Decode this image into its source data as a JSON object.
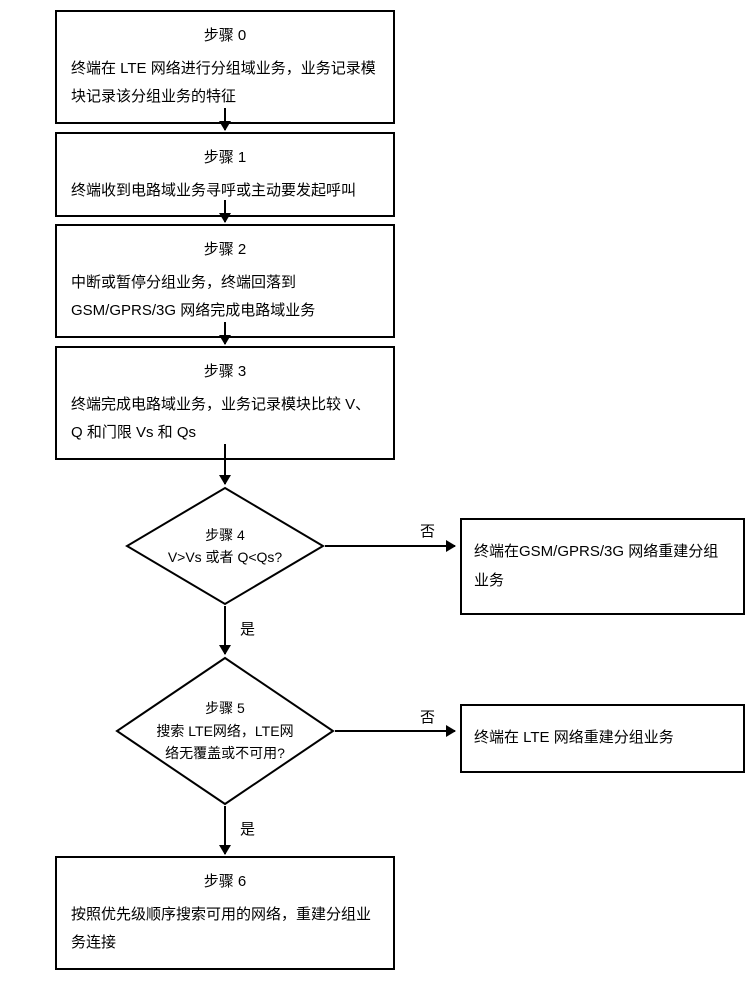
{
  "step0": {
    "title": "步骤 0",
    "text": "终端在 LTE 网络进行分组域业务，业务记录模块记录该分组业务的特征"
  },
  "step1": {
    "title": "步骤 1",
    "text": "终端收到电路域业务寻呼或主动要发起呼叫"
  },
  "step2": {
    "title": "步骤 2",
    "text": "中断或暂停分组业务，终端回落到GSM/GPRS/3G 网络完成电路域业务"
  },
  "step3": {
    "title": "步骤 3",
    "text": "终端完成电路域业务，业务记录模块比较 V、Q 和门限 Vs 和 Qs"
  },
  "step4": {
    "title": "步骤 4",
    "text": "V>Vs 或者 Q<Qs?"
  },
  "step4_no_result": "终端在GSM/GPRS/3G 网络重建分组业务",
  "step5": {
    "title": "步骤 5",
    "line1": "搜索 LTE网络，LTE网",
    "line2": "络无覆盖或不可用?"
  },
  "step5_no_result": "终端在 LTE 网络重建分组业务",
  "step6": {
    "title": "步骤 6",
    "text": "按照优先级顺序搜索可用的网络，重建分组业务连接"
  },
  "labels": {
    "yes": "是",
    "no": "否"
  }
}
